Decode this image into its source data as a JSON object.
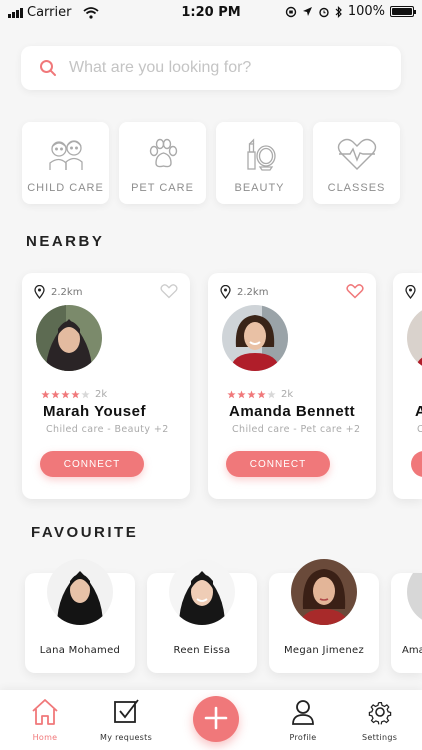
{
  "status_bar": {
    "carrier": "Carrier",
    "time": "1:20 PM",
    "battery": "100%"
  },
  "search": {
    "placeholder": "What are you looking for?"
  },
  "categories": [
    {
      "label": "CHILD CARE",
      "icon": "child-care-icon"
    },
    {
      "label": "PET CARE",
      "icon": "paw-icon"
    },
    {
      "label": "BEAUTY",
      "icon": "beauty-icon"
    },
    {
      "label": "CLASSES",
      "icon": "heart-pulse-icon"
    }
  ],
  "nearby": {
    "title": "NEARBY",
    "cards": [
      {
        "distance": "2.2km",
        "rating_stars": 4,
        "rating_count": "2k",
        "name": "Marah Yousef",
        "tags": "Chiled care - Beauty +2",
        "favourited": false,
        "connect_label": "CONNECT"
      },
      {
        "distance": "2.2km",
        "rating_stars": 4,
        "rating_count": "2k",
        "name": "Amanda Bennett",
        "tags": "Chiled care - Pet care  +2",
        "favourited": true,
        "connect_label": "CONNECT"
      },
      {
        "distance": "",
        "rating_stars": 0,
        "rating_count": "",
        "name": "A",
        "tags": "C",
        "favourited": false,
        "connect_label": ""
      }
    ]
  },
  "favourite": {
    "title": "FAVOURITE",
    "people": [
      {
        "name": "Lana Mohamed"
      },
      {
        "name": "Reen Eissa"
      },
      {
        "name": "Megan Jimenez"
      },
      {
        "name": "Ama"
      }
    ]
  },
  "tabbar": {
    "tabs": [
      {
        "label": "Home",
        "icon": "home-icon",
        "active": true
      },
      {
        "label": "My requests",
        "icon": "checkbox-icon",
        "active": false
      },
      {
        "label": "Profile",
        "icon": "profile-icon",
        "active": false
      },
      {
        "label": "Settings",
        "icon": "gear-icon",
        "active": false
      }
    ],
    "add_button_icon": "plus-icon"
  },
  "colors": {
    "accent": "#f0787a",
    "background": "#f6f6f6",
    "star_filled": "#f0787a",
    "star_empty": "#d8d8d8"
  }
}
